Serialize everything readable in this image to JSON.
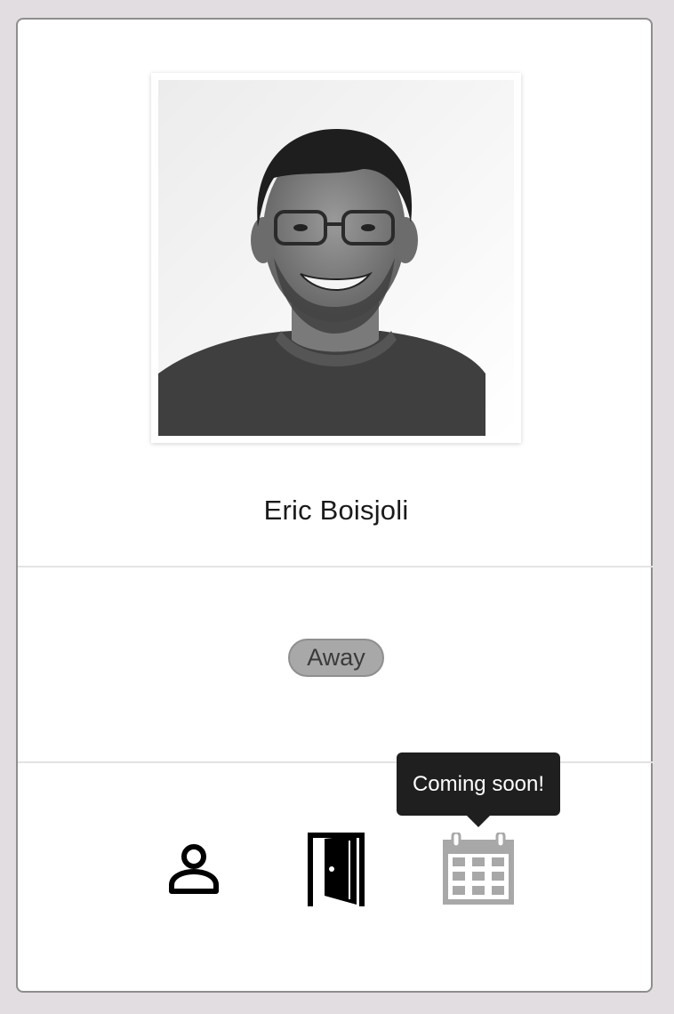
{
  "profile": {
    "name": "Eric Boisjoli",
    "photo_alt": "Eric Boisjoli"
  },
  "status": {
    "label": "Away",
    "color": "#a8a8a8"
  },
  "actions": [
    {
      "icon": "person-icon",
      "disabled": false
    },
    {
      "icon": "door-icon",
      "disabled": false
    },
    {
      "icon": "calendar-icon",
      "disabled": true
    }
  ],
  "tooltip": {
    "text": "Coming soon!"
  }
}
